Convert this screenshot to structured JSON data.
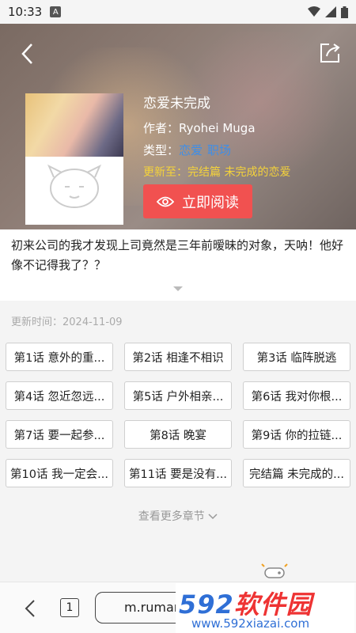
{
  "status_bar": {
    "time": "10:33",
    "a_badge": "A",
    "icons": [
      "wifi-icon",
      "signal-icon",
      "battery-icon"
    ]
  },
  "header": {
    "back_icon": "chevron-left-icon",
    "share_icon": "share-icon"
  },
  "comic": {
    "title": "恋爱未完成",
    "author_label": "作者：",
    "author": "Ryohei Muga",
    "genre_label": "类型：",
    "genres": [
      "恋爱",
      "职场"
    ],
    "update_label": "更新至：",
    "latest": "完结篇 未完成的恋爱",
    "read_button": "立即阅读",
    "description": "初来公司的我才发现上司竟然是三年前暧昧的对象，天呐！他好像不记得我了？？"
  },
  "chapters": {
    "update_time": "更新时间：2024-11-09",
    "items": [
      "第1话 意外的重...",
      "第2话 相逢不相识",
      "第3话 临阵脱逃",
      "第4话 忽近忽远...",
      "第5话 户外相亲...",
      "第6话 我对你根...",
      "第7话 要一起参...",
      "第8话 晚宴",
      "第9话 你的拉链...",
      "第10话 我一定会...",
      "第11话 要是没有...",
      "完结篇 未完成的..."
    ],
    "more": "查看更多章节"
  },
  "bottom_bar": {
    "tab_count": "1",
    "url": "m.ruman"
  },
  "watermark": {
    "logo_num": "592",
    "logo_cn": "软件园",
    "url": "www.592xiazai.com"
  },
  "colors": {
    "accent_red": "#f15150",
    "tag_blue": "#3e8ee8",
    "update_yellow": "#f5d33a"
  }
}
